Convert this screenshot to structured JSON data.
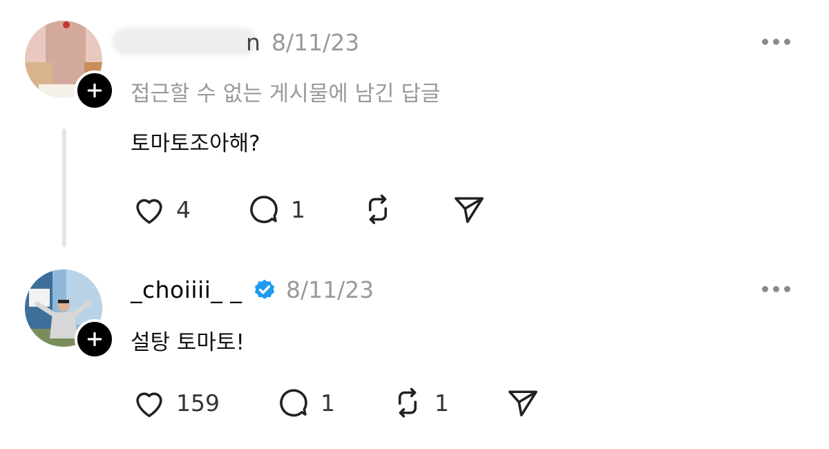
{
  "post1": {
    "username_suffix": "n",
    "date": "8/11/23",
    "inaccessible_note": "접근할 수 없는 게시물에 남긴 답글",
    "text": "토마토조아해?",
    "likes": "4",
    "replies": "1"
  },
  "post2": {
    "username": "_choiiii_ _",
    "date": "8/11/23",
    "text": "설탕 토마토!",
    "likes": "159",
    "replies": "1",
    "reposts": "1"
  },
  "colors": {
    "verified": "#1d9bf0",
    "muted": "#999999",
    "thread_line": "#e5e5e5"
  }
}
